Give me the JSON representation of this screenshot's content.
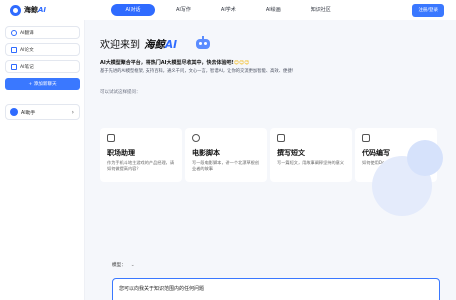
{
  "header": {
    "logo_text": "海鲸",
    "logo_ai": "AI",
    "nav": [
      {
        "label": "AI对话",
        "active": true
      },
      {
        "label": "AI写作",
        "active": false
      },
      {
        "label": "AI学术",
        "active": false
      },
      {
        "label": "AI绘画",
        "active": false
      },
      {
        "label": "知识社区",
        "active": false
      }
    ],
    "login_label": "注册/登录"
  },
  "sidebar": {
    "items": [
      {
        "label": "AI翻译",
        "icon": "translate-icon"
      },
      {
        "label": "AI论文",
        "icon": "paper-icon"
      },
      {
        "label": "AI笔记",
        "icon": "note-icon"
      }
    ],
    "new_chat_label": "+ 添加新聊天",
    "assistant_label": "AI助手",
    "assistant_chevron": "›"
  },
  "main": {
    "welcome": "欢迎来到",
    "brand": "海鲸",
    "brand_ai": "AI",
    "intro": "AI大模型聚合平台，将热门AI大模型尽收其中，快去体验吧!",
    "intro_emoji": "😊😊😊",
    "desc": "基于先进的AI模型框架, 支持百科，通义千问，文心一言，智谱AI，让你的交流更加智能、高效、便捷！",
    "try_label": "可以试试这样提问：",
    "cards": [
      {
        "title": "职场助理",
        "desc": "作为手机斗地主游戏的产品经理，请如何做提高内容？",
        "icon": "briefcase-icon"
      },
      {
        "title": "电影脚本",
        "desc": "写一段电影脚本，讲一个北漂草根创业者的故事",
        "icon": "film-icon"
      },
      {
        "title": "撰写短文",
        "desc": "写一篇短文，用故事阐释坚持的意义",
        "icon": "pen-icon"
      },
      {
        "title": "代码编写",
        "desc": "如何使用Docker配置mysql",
        "icon": "code-icon"
      }
    ],
    "model_label": "模型：",
    "model_chevron": "⌄",
    "input_placeholder": "您可以向我关于知识范围内的任何问题"
  }
}
